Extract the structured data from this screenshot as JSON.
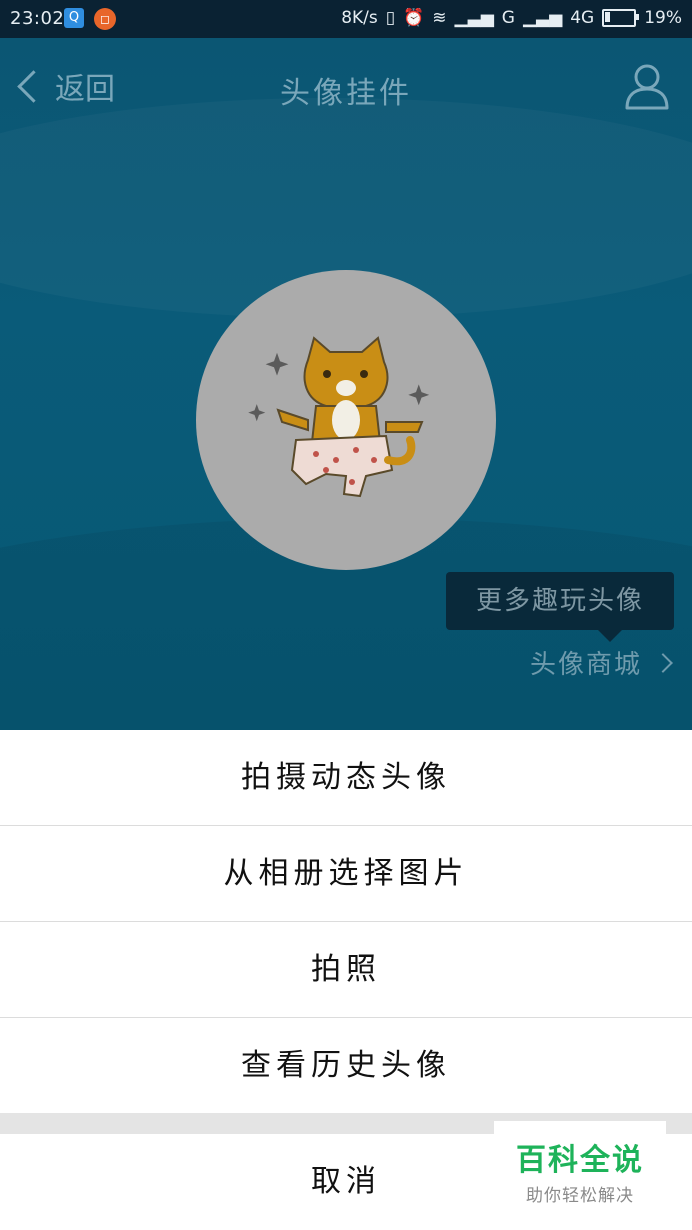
{
  "status_bar": {
    "time": "23:02",
    "speed": "8K/s",
    "signal_g": "G",
    "signal_4g": "4G",
    "battery": "19%",
    "battery_level": 0.19
  },
  "nav": {
    "back_label": "返回",
    "title": "头像挂件"
  },
  "hero": {
    "tooltip": "更多趣玩头像",
    "mall_link": "头像商城"
  },
  "action_sheet": {
    "items": [
      "拍摄动态头像",
      "从相册选择图片",
      "拍照",
      "查看历史头像"
    ],
    "cancel": "取消"
  },
  "watermark": {
    "title": "百科全说",
    "subtitle": "助你轻松解决"
  },
  "colors": {
    "hero_bg": "#0a5b79",
    "watermark_green": "#1eb35a"
  }
}
